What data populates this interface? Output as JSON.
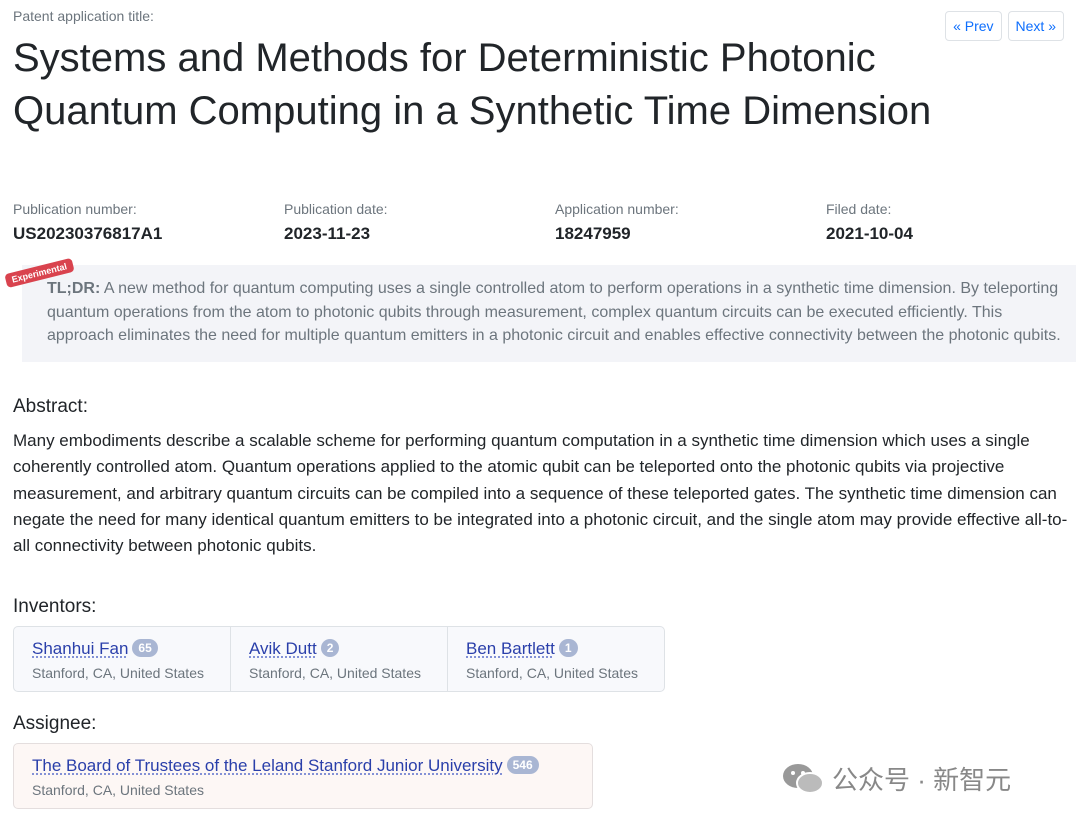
{
  "header": {
    "label": "Patent application title:",
    "title": "Systems and Methods for Deterministic Photonic Quantum Computing in a Synthetic Time Dimension",
    "prev": "« Prev",
    "next": "Next »"
  },
  "meta": [
    {
      "label": "Publication number:",
      "value": "US20230376817A1"
    },
    {
      "label": "Publication date:",
      "value": "2023-11-23"
    },
    {
      "label": "Application number:",
      "value": "18247959"
    },
    {
      "label": "Filed date:",
      "value": "2021-10-04"
    }
  ],
  "tldr": {
    "badge": "Experimental",
    "label": "TL;DR:",
    "text": " A new method for quantum computing uses a single controlled atom to perform operations in a synthetic time dimension. By teleporting quantum operations from the atom to photonic qubits through measurement, complex quantum circuits can be executed efficiently. This approach eliminates the need for multiple quantum emitters in a photonic circuit and enables effective connectivity between the photonic qubits."
  },
  "abstract": {
    "heading": "Abstract:",
    "text": "Many embodiments describe a scalable scheme for performing quantum computation in a synthetic time dimension which uses a single coherently controlled atom. Quantum operations applied to the atomic qubit can be teleported onto the photonic qubits via projective measurement, and arbitrary quantum circuits can be compiled into a sequence of these teleported gates. The synthetic time dimension can negate the need for many identical quantum emitters to be integrated into a photonic circuit, and the single atom may provide effective all-to-all connectivity between photonic qubits."
  },
  "inventors": {
    "heading": "Inventors:",
    "items": [
      {
        "name": "Shanhui Fan",
        "count": "65",
        "location": "Stanford, CA, United States"
      },
      {
        "name": "Avik Dutt",
        "count": "2",
        "location": "Stanford, CA, United States"
      },
      {
        "name": "Ben Bartlett",
        "count": "1",
        "location": "Stanford, CA, United States"
      }
    ]
  },
  "assignee": {
    "heading": "Assignee:",
    "name": "The Board of Trustees of the Leland Stanford Junior University",
    "count": "546",
    "location": "Stanford, CA, United States"
  },
  "watermark": {
    "text": "公众号 · 新智元",
    "icon": "wechat-icon"
  }
}
